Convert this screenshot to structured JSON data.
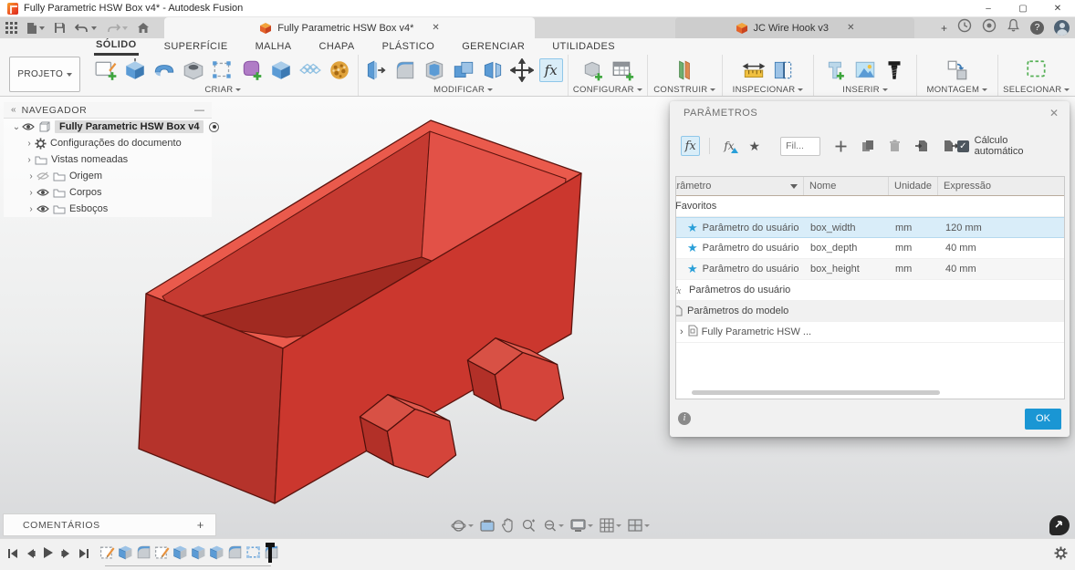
{
  "colors": {
    "accent_blue": "#1a96d4",
    "selection_row": "#d9edf9",
    "model_red": "#cb372e",
    "model_red_dark": "#b5332b",
    "model_red_bright": "#e25147"
  },
  "icons": {
    "close": "✕",
    "plus": "+",
    "minus": "—",
    "minimize": "–",
    "maximize": "▢",
    "collapse": "«",
    "chevron_down": "⌄",
    "chevron_right": "›",
    "help": "?",
    "star": "★",
    "info": "i",
    "check": "✓"
  },
  "titlebar": {
    "title": "Fully Parametric HSW Box v4* - Autodesk Fusion"
  },
  "doc_tabs": {
    "active": {
      "label": "Fully Parametric HSW Box v4*"
    },
    "inactive": {
      "label": "JC Wire Hook v3"
    }
  },
  "ribbon": {
    "project_button": "PROJETO",
    "tabs": [
      {
        "label": "SÓLIDO",
        "active": true
      },
      {
        "label": "SUPERFÍCIE"
      },
      {
        "label": "MALHA"
      },
      {
        "label": "CHAPA"
      },
      {
        "label": "PLÁSTICO"
      },
      {
        "label": "GERENCIAR"
      },
      {
        "label": "UTILIDADES"
      }
    ],
    "groups": [
      {
        "label": "CRIAR"
      },
      {
        "label": "MODIFICAR"
      },
      {
        "label": "CONFIGURAR"
      },
      {
        "label": "CONSTRUIR"
      },
      {
        "label": "INSPECIONAR"
      },
      {
        "label": "INSERIR"
      },
      {
        "label": "MONTAGEM"
      },
      {
        "label": "SELECIONAR"
      }
    ]
  },
  "browser": {
    "title": "NAVEGADOR",
    "root": {
      "label": "Fully Parametric HSW Box v4"
    },
    "items": [
      {
        "label": "Configurações do documento"
      },
      {
        "label": "Vistas nomeadas"
      },
      {
        "label": "Origem"
      },
      {
        "label": "Corpos"
      },
      {
        "label": "Esboços"
      }
    ]
  },
  "dialog": {
    "title": "PARÂMETROS",
    "filter_placeholder": "Fil...",
    "auto_label": "Cálculo automático",
    "auto_checked": true,
    "columns": [
      "Parâmetro",
      "Nome",
      "Unidade",
      "Expressão"
    ],
    "sections": {
      "favorites": "Favoritos",
      "user": "Parâmetros do usuário",
      "model": "Parâmetros do modelo",
      "component": "Fully Parametric HSW ..."
    },
    "rows": [
      {
        "type": "Parâmetro do usuário",
        "name": "box_width",
        "unit": "mm",
        "expression": "120 mm",
        "selected": true
      },
      {
        "type": "Parâmetro do usuário",
        "name": "box_depth",
        "unit": "mm",
        "expression": "40 mm"
      },
      {
        "type": "Parâmetro do usuário",
        "name": "box_height",
        "unit": "mm",
        "expression": "40 mm"
      }
    ],
    "ok_label": "OK"
  },
  "comments": {
    "label": "COMENTÁRIOS"
  }
}
